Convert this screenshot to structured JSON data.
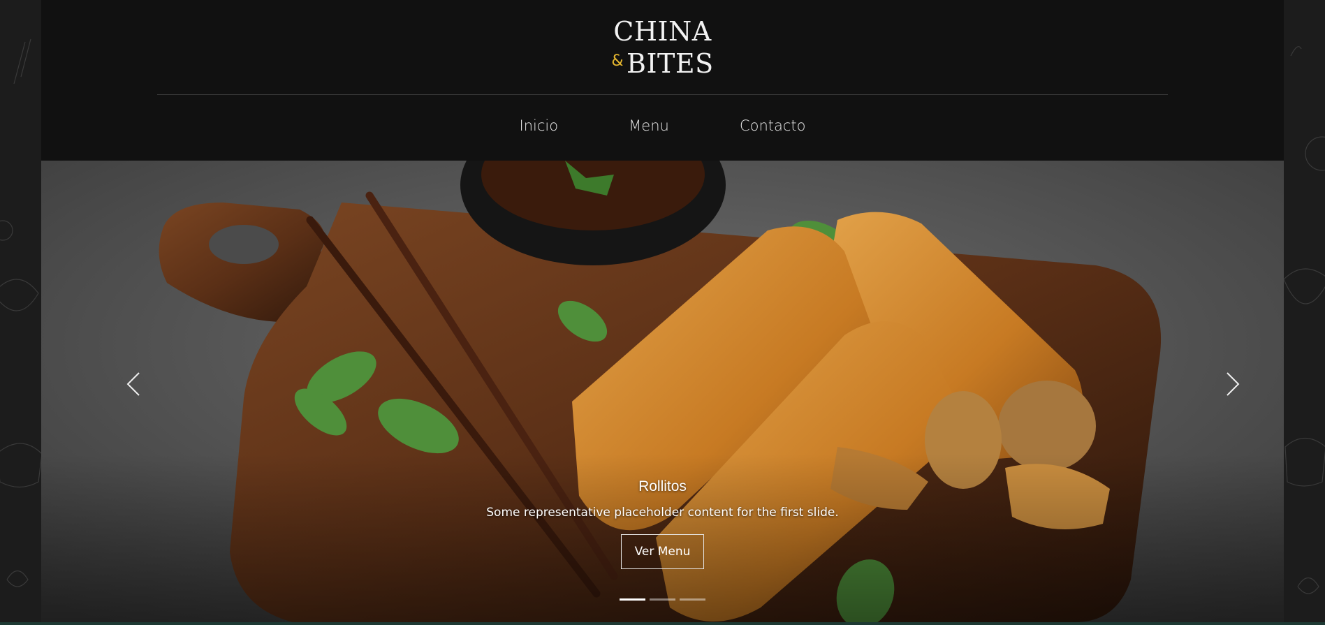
{
  "brand": {
    "line1": "CHINA",
    "ampersand": "&",
    "line2": "BITES",
    "accent_color": "#e5b62f"
  },
  "nav": {
    "items": [
      {
        "label": "Inicio"
      },
      {
        "label": "Menu"
      },
      {
        "label": "Contacto"
      }
    ]
  },
  "carousel": {
    "slide_title": "Rollitos",
    "slide_text": "Some representative placeholder content for the first slide.",
    "button_label": "Ver Menu",
    "prev_icon": "chevron-left-icon",
    "next_icon": "chevron-right-icon",
    "slide_count": 3,
    "active_index": 0
  },
  "colors": {
    "background": "#111111",
    "page_gutter": "#1c1c1c",
    "text": "#f2f2f2"
  }
}
